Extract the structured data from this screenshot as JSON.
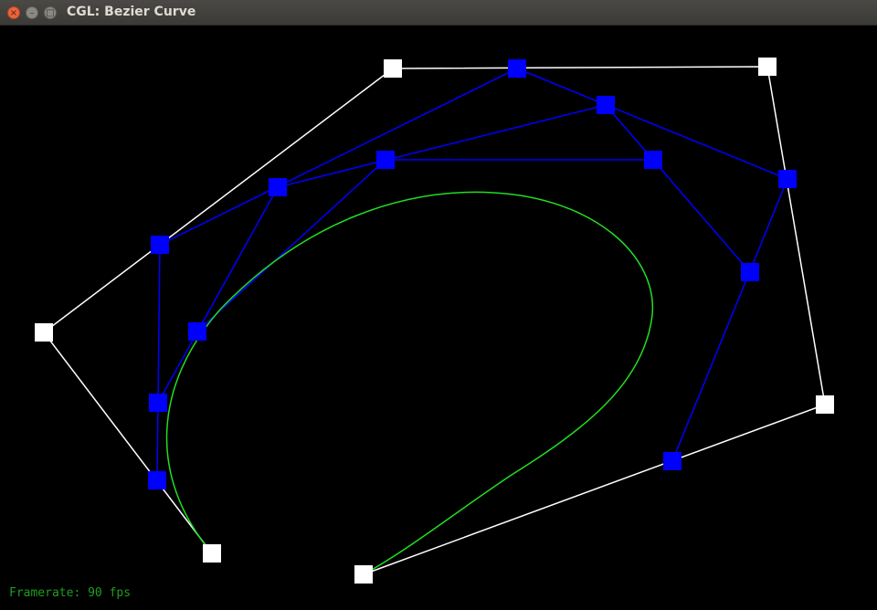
{
  "window": {
    "title": "CGL: Bezier Curve",
    "controls": [
      "close-icon",
      "minimize-icon",
      "maximize-icon"
    ]
  },
  "status": {
    "framerate": "Framerate: 90 fps"
  },
  "colors": {
    "background": "#000000",
    "control_polygon": "#ffffff",
    "intermediate": "#0000ff",
    "curve": "#22dd22",
    "framerate_text": "#1f9e1f"
  }
}
